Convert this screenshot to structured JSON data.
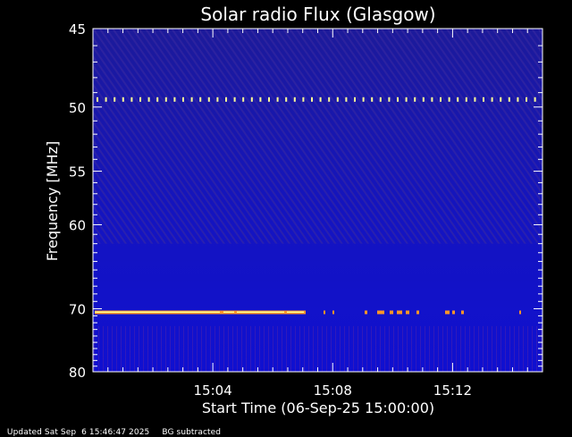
{
  "chart_data": {
    "type": "heatmap",
    "title": "Solar radio Flux (Glasgow)",
    "xlabel": "Start Time (06-Sep-25 15:00:00)",
    "ylabel": "Frequency [MHz]",
    "x_ticks": [
      "15:04",
      "15:08",
      "15:12"
    ],
    "x_tick_minutes": [
      4,
      8,
      12
    ],
    "xlim_minutes": [
      0,
      15
    ],
    "y_ticks": [
      "45",
      "50",
      "55",
      "60",
      "70",
      "80"
    ],
    "y_tick_values": [
      45,
      50,
      55,
      60,
      70,
      80
    ],
    "ylim": [
      45,
      80
    ],
    "y_scale": "reciprocal",
    "colormap": [
      "#0a0a78",
      "#1414d2",
      "#5028c8",
      "#b43250",
      "#ff9628",
      "#ffff96"
    ],
    "features": [
      {
        "frequency_mhz": 49.5,
        "kind": "periodic interference dashes"
      },
      {
        "frequency_mhz": 70.5,
        "kind": "continuous interference line"
      }
    ]
  },
  "footer": {
    "updated": "Updated Sat Sep  6 15:46:47 2025",
    "note": "BG subtracted"
  }
}
